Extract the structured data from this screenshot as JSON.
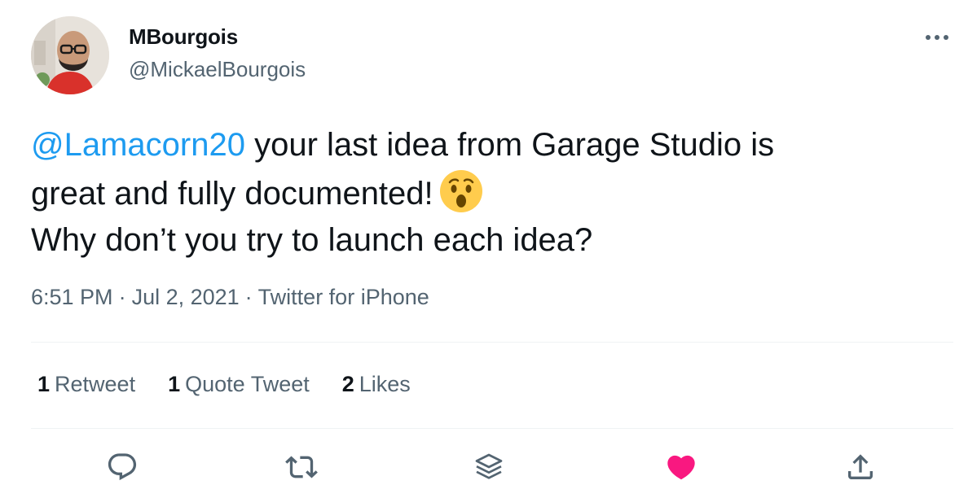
{
  "author": {
    "display_name": "MBourgois",
    "handle": "@MickaelBourgois",
    "avatar_icon": "user-avatar-photo"
  },
  "tweet": {
    "mention": "@Lamacorn20",
    "line1_rest": " your last idea from Garage Studio is",
    "line2": "great and fully documented!",
    "emoji": "hushed-face-emoji",
    "line3": "Why don’t you try to launch each idea?"
  },
  "meta": {
    "time": "6:51 PM",
    "separator": "·",
    "date": "Jul 2, 2021",
    "source": "Twitter for iPhone"
  },
  "stats": {
    "retweets": {
      "count": "1",
      "label": "Retweet"
    },
    "quotes": {
      "count": "1",
      "label": "Quote Tweet"
    },
    "likes": {
      "count": "2",
      "label": "Likes"
    }
  },
  "actions": {
    "reply_icon": "reply-icon",
    "retweet_icon": "retweet-icon",
    "revue_icon": "layers-icon",
    "like_icon": "heart-filled-icon",
    "share_icon": "share-icon"
  },
  "colors": {
    "link": "#1d9bf0",
    "secondary_text": "#536471",
    "primary_text": "#0f1419",
    "like": "#f91880",
    "divider": "#eff3f4"
  }
}
